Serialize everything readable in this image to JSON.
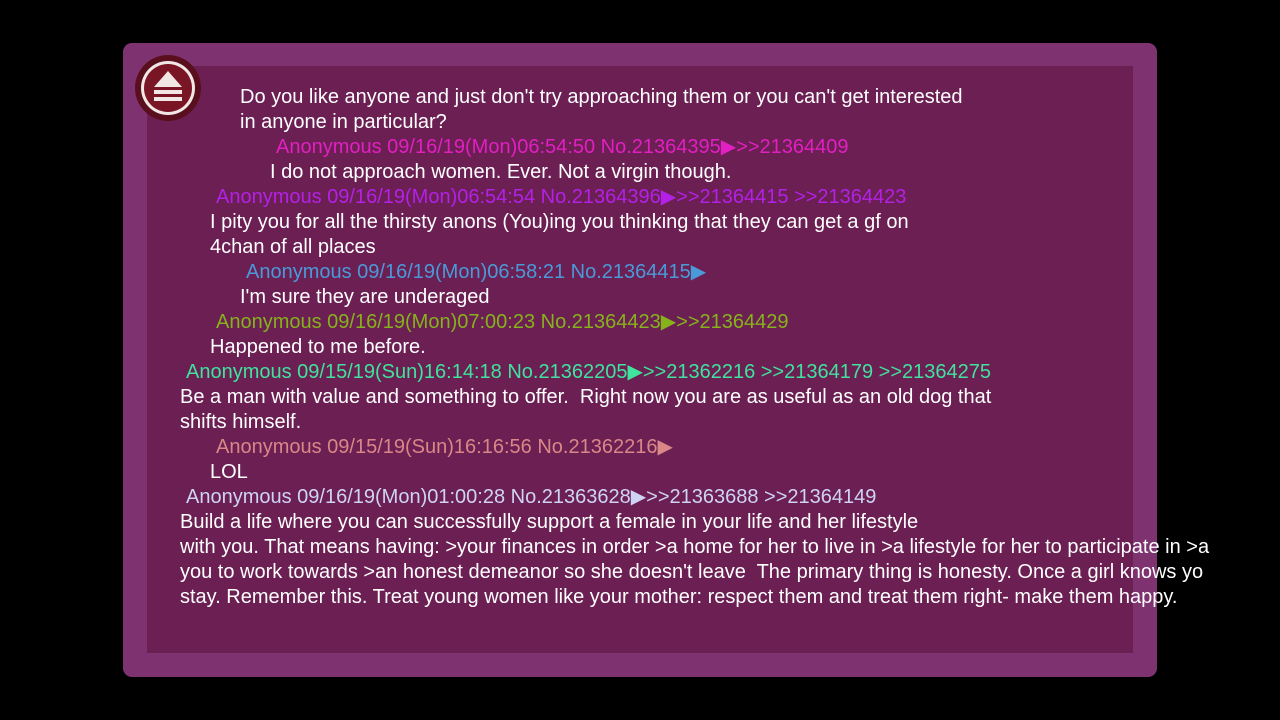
{
  "colors": {
    "background": "#000000",
    "frame": "#7e3270",
    "panel": "#6b1f53",
    "text": "#ffffff"
  },
  "eject_icon": "eject-icon",
  "thread": [
    {
      "kind": "body",
      "lines": [
        "Do you like anyone and just don't try approaching them or you can't get interested",
        "in anyone in particular?"
      ]
    },
    {
      "kind": "reply",
      "color": "#e21fc2",
      "header": "Anonymous 09/16/19(Mon)06:54:50 No.21364395",
      "arrow": "▶",
      "refs": ">>21364409",
      "lines": [
        "I do not approach women. Ever. Not a virgin though."
      ]
    },
    {
      "kind": "reply",
      "color": "#b321e6",
      "header": "Anonymous 09/16/19(Mon)06:54:54 No.21364396",
      "arrow": "▶",
      "refs": ">>21364415 >>21364423",
      "lines": [
        "I pity you for all the thirsty anons (You)ing you thinking that they can get a gf on",
        "4chan of all places"
      ]
    },
    {
      "kind": "reply",
      "color": "#4a9ad8",
      "header": "Anonymous 09/16/19(Mon)06:58:21 No.21364415",
      "arrow": "▶",
      "refs": "",
      "lines": [
        "I'm sure they are underaged"
      ]
    },
    {
      "kind": "reply",
      "color": "#86b21b",
      "header": "Anonymous 09/16/19(Mon)07:00:23 No.21364423",
      "arrow": "▶",
      "refs": ">>21364429",
      "lines": [
        "Happened to me before."
      ]
    },
    {
      "kind": "reply",
      "color": "#40e29c",
      "header": "Anonymous 09/15/19(Sun)16:14:18 No.21362205",
      "arrow": "▶",
      "refs": ">>21362216 >>21364179 >>21364275",
      "lines": [
        "Be a man with value and something to offer.  Right now you are as useful as an old dog that",
        "shifts himself."
      ]
    },
    {
      "kind": "reply",
      "color": "#d98787",
      "header": "Anonymous 09/15/19(Sun)16:16:56 No.21362216",
      "arrow": "▶",
      "refs": "",
      "lines": [
        "LOL"
      ]
    },
    {
      "kind": "reply",
      "color": "#cfd3f4",
      "header": "Anonymous 09/16/19(Mon)01:00:28 No.21363628",
      "arrow": "▶",
      "refs": ">>21363688 >>21364149",
      "lines": [
        "Build a life where you can successfully support a female in your life and her lifestyle",
        "with you. That means having: >your finances in order >a home for her to live in >a lifestyle for her to participate in >a",
        "you to work towards >an honest demeanor so she doesn't leave  The primary thing is honesty. Once a girl knows yo",
        "stay. Remember this. Treat young women like your mother: respect them and treat them right- make them happy."
      ]
    }
  ]
}
